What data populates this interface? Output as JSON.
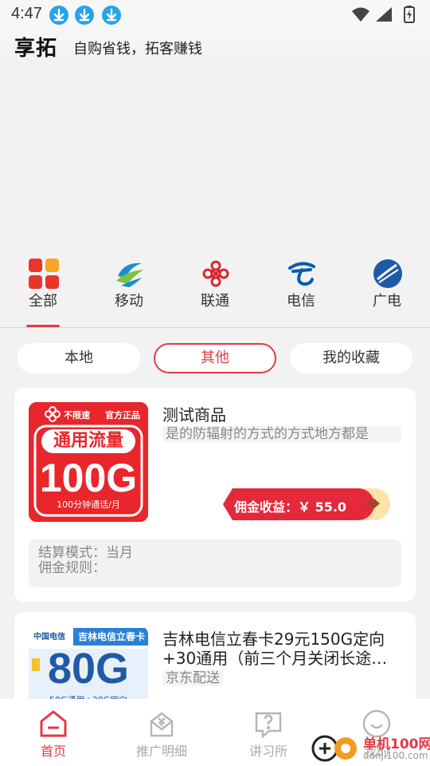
{
  "status": {
    "time": "4:47"
  },
  "header": {
    "logo": "享拓",
    "slogan": "自购省钱，拓客赚钱"
  },
  "categories": [
    {
      "label": "全部",
      "icon": "grid-icon",
      "active": true
    },
    {
      "label": "移动",
      "icon": "china-mobile-icon"
    },
    {
      "label": "联通",
      "icon": "china-unicom-icon"
    },
    {
      "label": "电信",
      "icon": "china-telecom-icon"
    },
    {
      "label": "广电",
      "icon": "china-broadnet-icon"
    }
  ],
  "filters": [
    {
      "label": "本地"
    },
    {
      "label": "其他",
      "active": true
    },
    {
      "label": "我的收藏"
    }
  ],
  "products": [
    {
      "title": "测试商品",
      "desc": "是的防辐射的方式的方式地方都是",
      "commission_label": "佣金收益：￥ 55.0",
      "settle_mode": "结算模式：当月",
      "commission_rule": "佣金规则：",
      "image_text": {
        "tag1": "不限速",
        "tag2": "官方正品",
        "headline": "通用流量",
        "amount": "100G",
        "sub": "100分钟通话/月"
      }
    },
    {
      "title_line1": "吉林电信立春卡29元150G定向",
      "title_line2": "+30通用（前三个月关闭长途…",
      "tag": "京东配送",
      "image_text": {
        "brand": "中国电信",
        "banner": "吉林电信立春卡",
        "amount": "80G",
        "sub": "50G通用+30G定向"
      }
    }
  ],
  "bottom_nav": [
    {
      "label": "首页",
      "icon": "home-icon",
      "active": true
    },
    {
      "label": "推广明细",
      "icon": "promotion-detail-icon"
    },
    {
      "label": "讲习所",
      "icon": "question-chat-icon"
    },
    {
      "label": "我的",
      "icon": "profile-icon"
    }
  ],
  "watermark": {
    "site": "单机100网",
    "url": "danji100.com"
  },
  "colors": {
    "accent": "#e23a47",
    "download": "#27a3e8"
  }
}
